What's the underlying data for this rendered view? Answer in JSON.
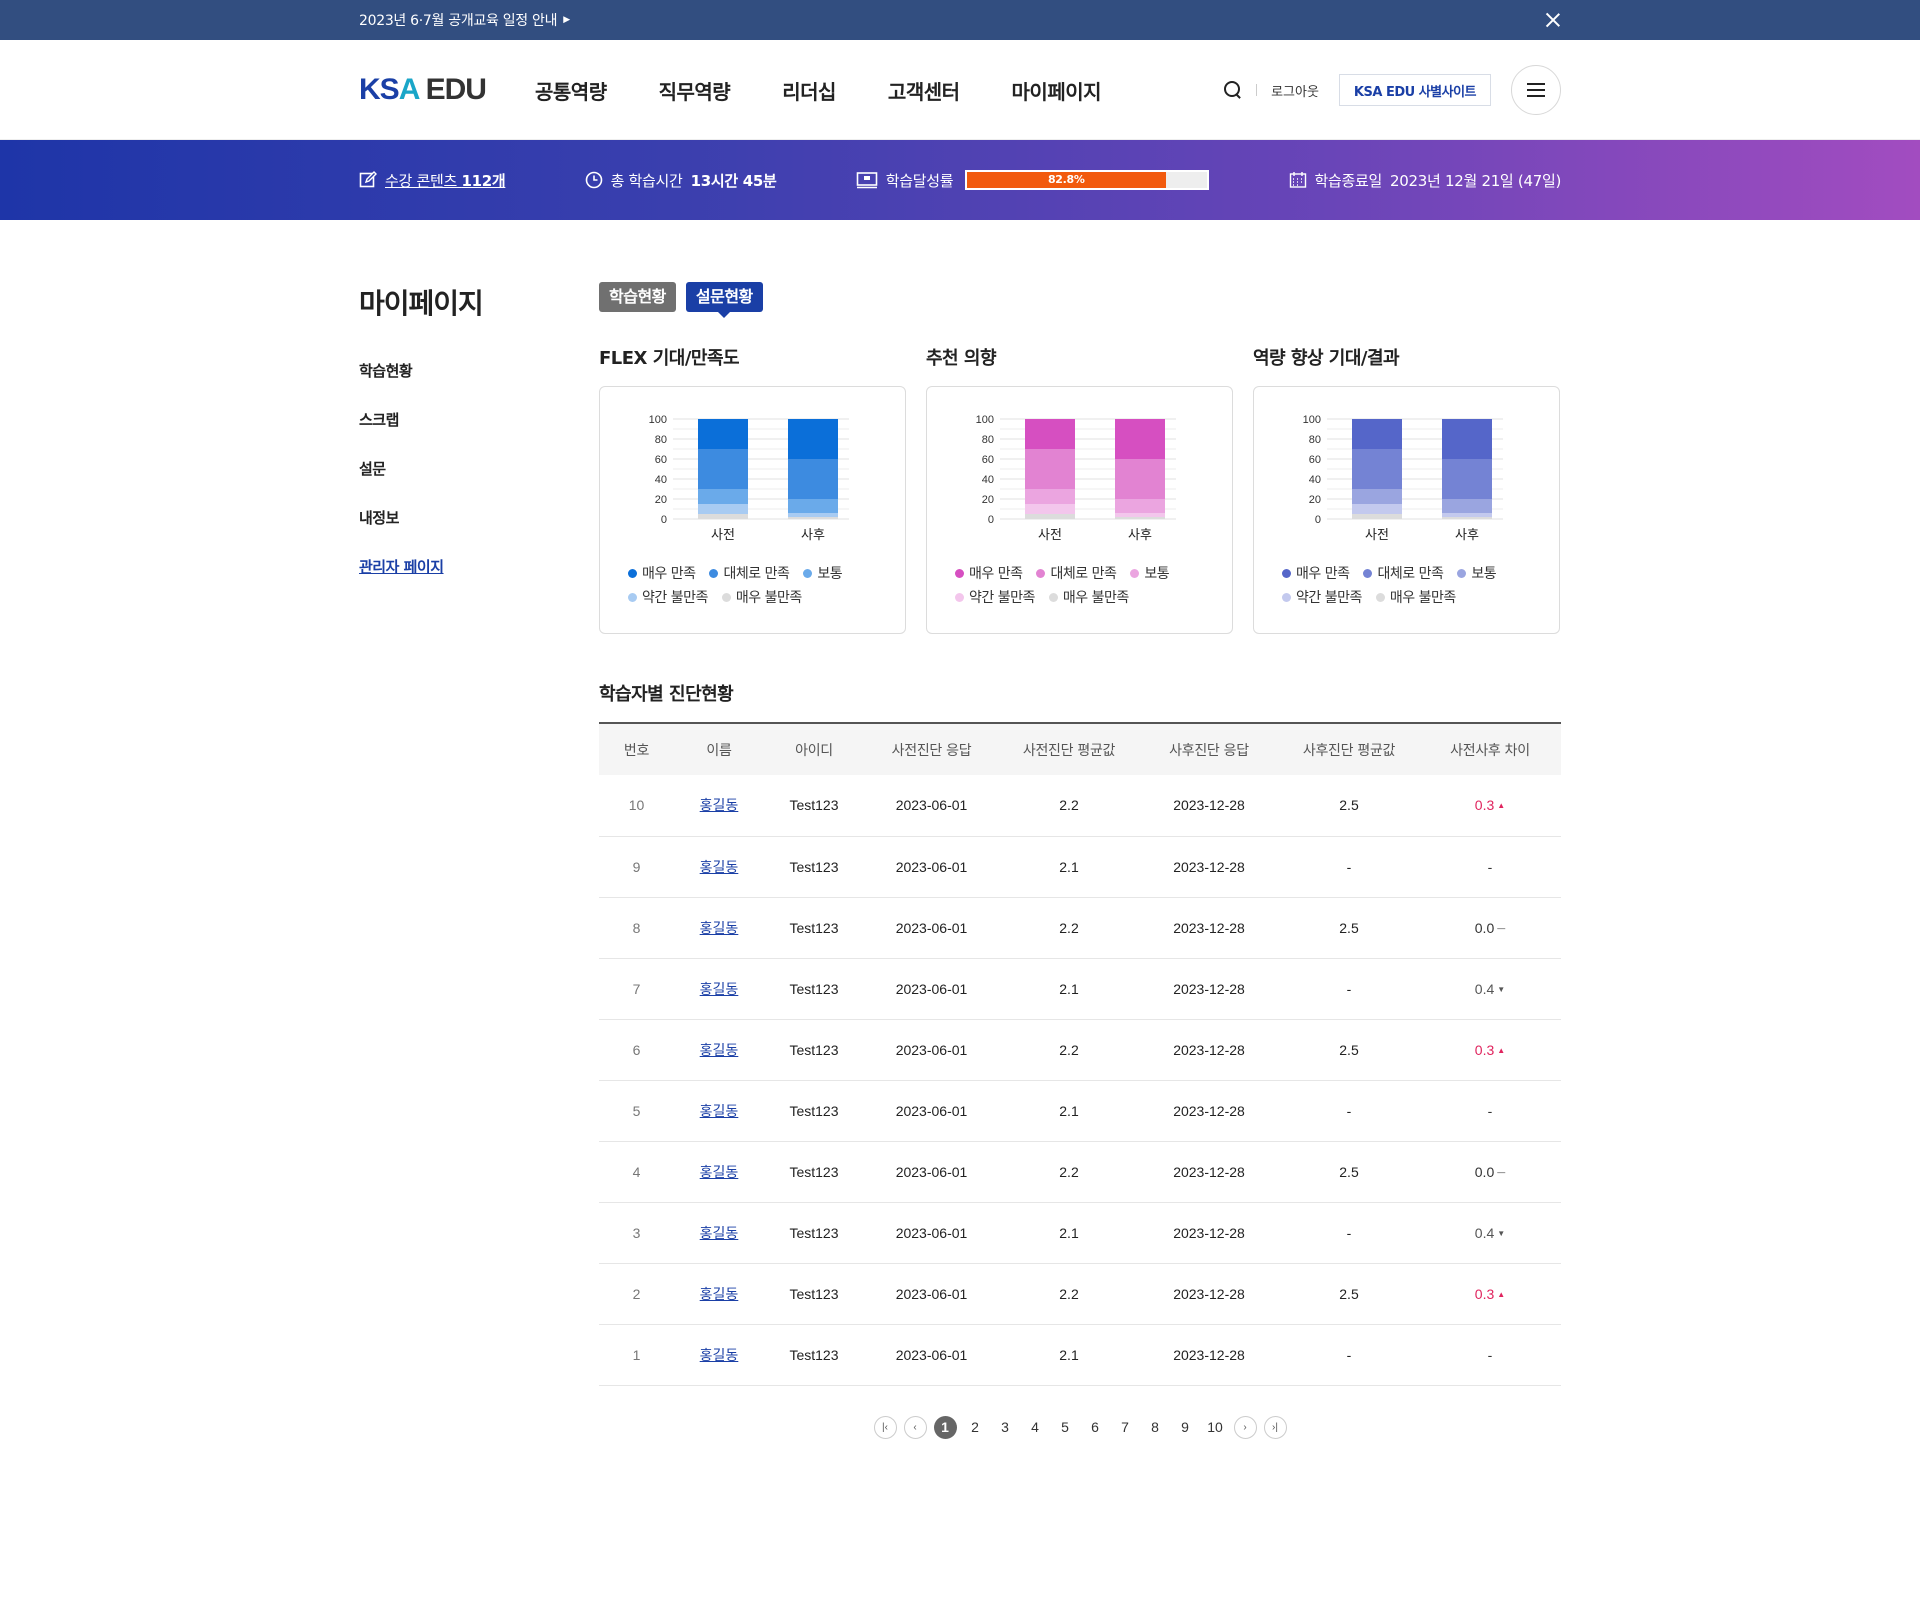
{
  "notice": {
    "text": "2023년 6·7월 공개교육 일정 안내"
  },
  "header": {
    "logo_ksa": "KS",
    "logo_a": "A",
    "logo_edu": "EDU",
    "nav": [
      "공통역량",
      "직무역량",
      "리더십",
      "고객센터",
      "마이페이지"
    ],
    "logout": "로그아웃",
    "partner_site": "KSA EDU 사별사이트"
  },
  "stats": {
    "contents_label": "수강 콘텐츠",
    "contents_value": "112개",
    "time_label": "총 학습시간",
    "time_value": "13시간 45분",
    "rate_label": "학습달성률",
    "rate_value": "82.8%",
    "rate_fraction": 0.828,
    "end_label": "학습종료일",
    "end_value": "2023년 12월 21일 (47일)"
  },
  "sidebar": {
    "title": "마이페이지",
    "items": [
      "학습현황",
      "스크랩",
      "설문",
      "내정보",
      "관리자 페이지"
    ]
  },
  "tabs": [
    "학습현황",
    "설문현황"
  ],
  "chart_data": [
    {
      "type": "bar",
      "stacked": true,
      "title": "FLEX 기대/만족도",
      "categories": [
        "사전",
        "사후"
      ],
      "ylim": [
        0,
        100
      ],
      "yticks": [
        0,
        20,
        40,
        60,
        80,
        100
      ],
      "series": [
        {
          "name": "매우 만족",
          "values": [
            30,
            40
          ],
          "color": "#0b6fd9"
        },
        {
          "name": "대체로 만족",
          "values": [
            40,
            40
          ],
          "color": "#3d8be0"
        },
        {
          "name": "보통",
          "values": [
            15,
            14
          ],
          "color": "#6aaaea"
        },
        {
          "name": "약간 불만족",
          "values": [
            10,
            4
          ],
          "color": "#a8cbf2"
        },
        {
          "name": "매우 불만족",
          "values": [
            5,
            2
          ],
          "color": "#dcdcdc"
        }
      ]
    },
    {
      "type": "bar",
      "stacked": true,
      "title": "추천 의향",
      "categories": [
        "사전",
        "사후"
      ],
      "ylim": [
        0,
        100
      ],
      "yticks": [
        0,
        20,
        40,
        60,
        80,
        100
      ],
      "series": [
        {
          "name": "매우 만족",
          "values": [
            30,
            40
          ],
          "color": "#d64fc1"
        },
        {
          "name": "대체로 만족",
          "values": [
            40,
            40
          ],
          "color": "#e283d2"
        },
        {
          "name": "보통",
          "values": [
            15,
            14
          ],
          "color": "#eba5e0"
        },
        {
          "name": "약간 불만족",
          "values": [
            10,
            4
          ],
          "color": "#f3c6ec"
        },
        {
          "name": "매우 불만족",
          "values": [
            5,
            2
          ],
          "color": "#dcdcdc"
        }
      ]
    },
    {
      "type": "bar",
      "stacked": true,
      "title": "역량 향상 기대/결과",
      "categories": [
        "사전",
        "사후"
      ],
      "ylim": [
        0,
        100
      ],
      "yticks": [
        0,
        20,
        40,
        60,
        80,
        100
      ],
      "series": [
        {
          "name": "매우 만족",
          "values": [
            30,
            40
          ],
          "color": "#5566c9"
        },
        {
          "name": "대체로 만족",
          "values": [
            40,
            40
          ],
          "color": "#7483d4"
        },
        {
          "name": "보통",
          "values": [
            15,
            14
          ],
          "color": "#9aa5e0"
        },
        {
          "name": "약간 불만족",
          "values": [
            10,
            4
          ],
          "color": "#c3c9ee"
        },
        {
          "name": "매우 불만족",
          "values": [
            5,
            2
          ],
          "color": "#dcdcdc"
        }
      ]
    }
  ],
  "table": {
    "title": "학습자별 진단현황",
    "headers": [
      "번호",
      "이름",
      "아이디",
      "사전진단 응답",
      "사전진단 평균값",
      "사후진단 응답",
      "사후진단 평균값",
      "사전사후 차이"
    ],
    "rows": [
      {
        "no": "10",
        "name": "홍길동",
        "id": "Test123",
        "pre_date": "2023-06-01",
        "pre_avg": "2.2",
        "post_date": "2023-12-28",
        "post_avg": "2.5",
        "diff": "0.3",
        "trend": "up"
      },
      {
        "no": "9",
        "name": "홍길동",
        "id": "Test123",
        "pre_date": "2023-06-01",
        "pre_avg": "2.1",
        "post_date": "2023-12-28",
        "post_avg": "-",
        "diff": "-",
        "trend": "none"
      },
      {
        "no": "8",
        "name": "홍길동",
        "id": "Test123",
        "pre_date": "2023-06-01",
        "pre_avg": "2.2",
        "post_date": "2023-12-28",
        "post_avg": "2.5",
        "diff": "0.0",
        "trend": "eq"
      },
      {
        "no": "7",
        "name": "홍길동",
        "id": "Test123",
        "pre_date": "2023-06-01",
        "pre_avg": "2.1",
        "post_date": "2023-12-28",
        "post_avg": "-",
        "diff": "0.4",
        "trend": "down"
      },
      {
        "no": "6",
        "name": "홍길동",
        "id": "Test123",
        "pre_date": "2023-06-01",
        "pre_avg": "2.2",
        "post_date": "2023-12-28",
        "post_avg": "2.5",
        "diff": "0.3",
        "trend": "up"
      },
      {
        "no": "5",
        "name": "홍길동",
        "id": "Test123",
        "pre_date": "2023-06-01",
        "pre_avg": "2.1",
        "post_date": "2023-12-28",
        "post_avg": "-",
        "diff": "-",
        "trend": "none"
      },
      {
        "no": "4",
        "name": "홍길동",
        "id": "Test123",
        "pre_date": "2023-06-01",
        "pre_avg": "2.2",
        "post_date": "2023-12-28",
        "post_avg": "2.5",
        "diff": "0.0",
        "trend": "eq"
      },
      {
        "no": "3",
        "name": "홍길동",
        "id": "Test123",
        "pre_date": "2023-06-01",
        "pre_avg": "2.1",
        "post_date": "2023-12-28",
        "post_avg": "-",
        "diff": "0.4",
        "trend": "down"
      },
      {
        "no": "2",
        "name": "홍길동",
        "id": "Test123",
        "pre_date": "2023-06-01",
        "pre_avg": "2.2",
        "post_date": "2023-12-28",
        "post_avg": "2.5",
        "diff": "0.3",
        "trend": "up"
      },
      {
        "no": "1",
        "name": "홍길동",
        "id": "Test123",
        "pre_date": "2023-06-01",
        "pre_avg": "2.1",
        "post_date": "2023-12-28",
        "post_avg": "-",
        "diff": "-",
        "trend": "none"
      }
    ]
  },
  "pagination": {
    "pages": [
      "1",
      "2",
      "3",
      "4",
      "5",
      "6",
      "7",
      "8",
      "9",
      "10"
    ],
    "current": "1"
  },
  "colors": {
    "brand": "#1a3fa6",
    "accent_orange": "#f25a0d",
    "up": "#e0245e"
  }
}
